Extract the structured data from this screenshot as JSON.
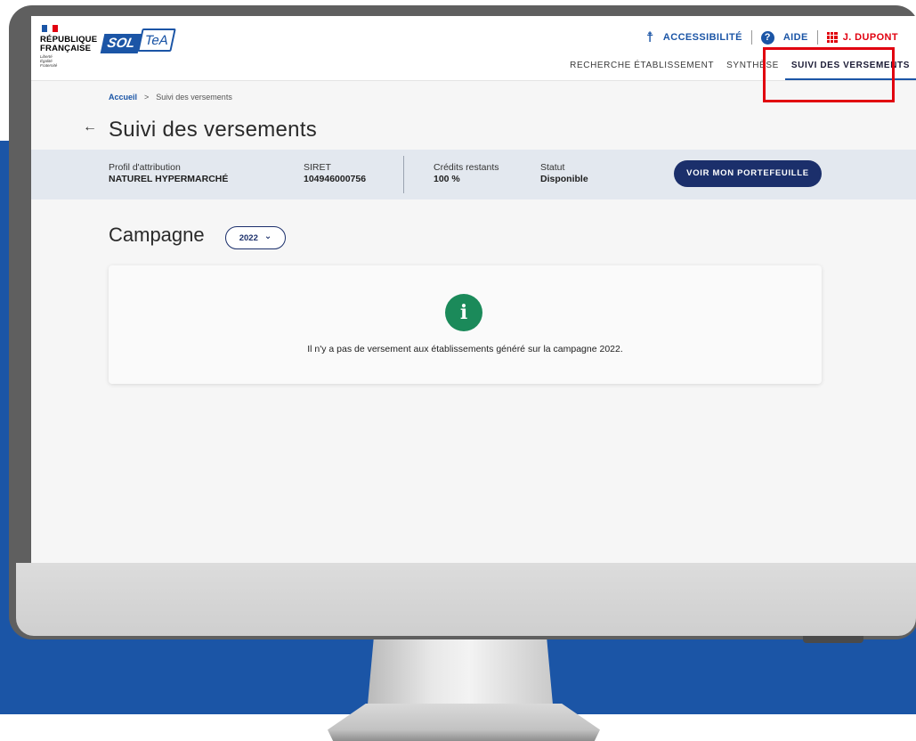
{
  "header": {
    "marianne": "RÉPUBLIQUE FRANÇAISE",
    "devise": "Liberté Égalité Fraternité",
    "logo_sol": "SOL",
    "logo_tea": "TeA",
    "tools": {
      "accessibility": "ACCESSIBILITÉ",
      "help": "AIDE",
      "user": "J. DUPONT"
    },
    "nav": [
      {
        "label": "RECHERCHE ÉTABLISSEMENT",
        "active": false
      },
      {
        "label": "SYNTHÈSE",
        "active": false
      },
      {
        "label": "SUIVI DES VERSEMENTS",
        "active": true
      }
    ]
  },
  "breadcrumb": {
    "home": "Accueil",
    "separator": ">",
    "current": "Suivi des versements"
  },
  "page": {
    "back_icon": "←",
    "title": "Suivi des versements"
  },
  "info_band": {
    "profil_label": "Profil d'attribution",
    "profil_value": "NATUREL HYPERMARCHÉ",
    "siret_label": "SIRET",
    "siret_value": "104946000756",
    "credits_label": "Crédits restants",
    "credits_value": "100 %",
    "statut_label": "Statut",
    "statut_value": "Disponible",
    "portfolio_button": "VOIR MON PORTEFEUILLE"
  },
  "campaign": {
    "label": "Campagne",
    "selected_year": "2022",
    "chevron": "⌄"
  },
  "message_card": {
    "icon": "i",
    "text": "Il n'y a pas de versement aux établissements généré sur la campagne 2022."
  },
  "colors": {
    "brand_blue": "#1b55a6",
    "dark_blue": "#1b2f6b",
    "highlight_red": "#e1000f",
    "info_green": "#1b8a5a"
  }
}
